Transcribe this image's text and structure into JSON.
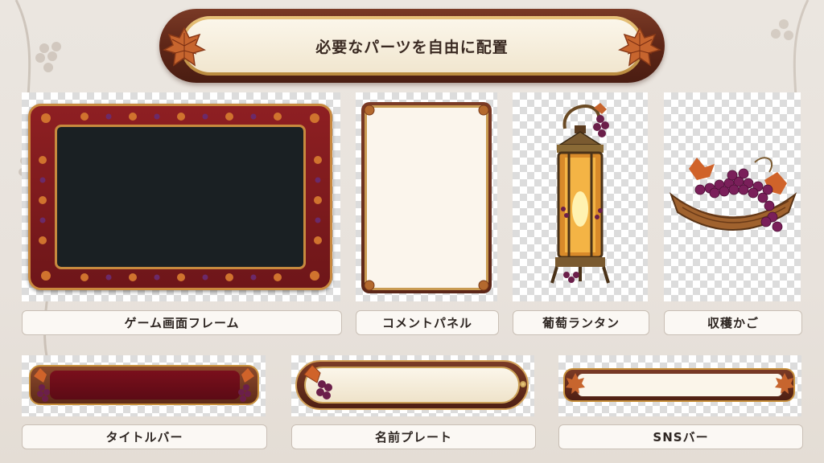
{
  "banner": {
    "title": "必要なパーツを自由に配置"
  },
  "parts": [
    {
      "id": "game-frame",
      "label": "ゲーム画面フレーム"
    },
    {
      "id": "comment-panel",
      "label": "コメントパネル"
    },
    {
      "id": "grape-lantern",
      "label": "葡萄ランタン"
    },
    {
      "id": "harvest-basket",
      "label": "収穫かご"
    },
    {
      "id": "title-bar",
      "label": "タイトルバー"
    },
    {
      "id": "name-plate",
      "label": "名前プレート"
    },
    {
      "id": "sns-bar",
      "label": "SNSバー"
    }
  ],
  "colors": {
    "wood": "#5e2617",
    "gold": "#c9923e",
    "wine": "#7a0f1c",
    "cream": "#fbf6ea",
    "grape": "#6b1f4a",
    "leaf": "#c7652e"
  },
  "icons": [
    "grape-leaf-icon",
    "grape-cluster-icon",
    "lantern-icon",
    "basket-icon"
  ]
}
